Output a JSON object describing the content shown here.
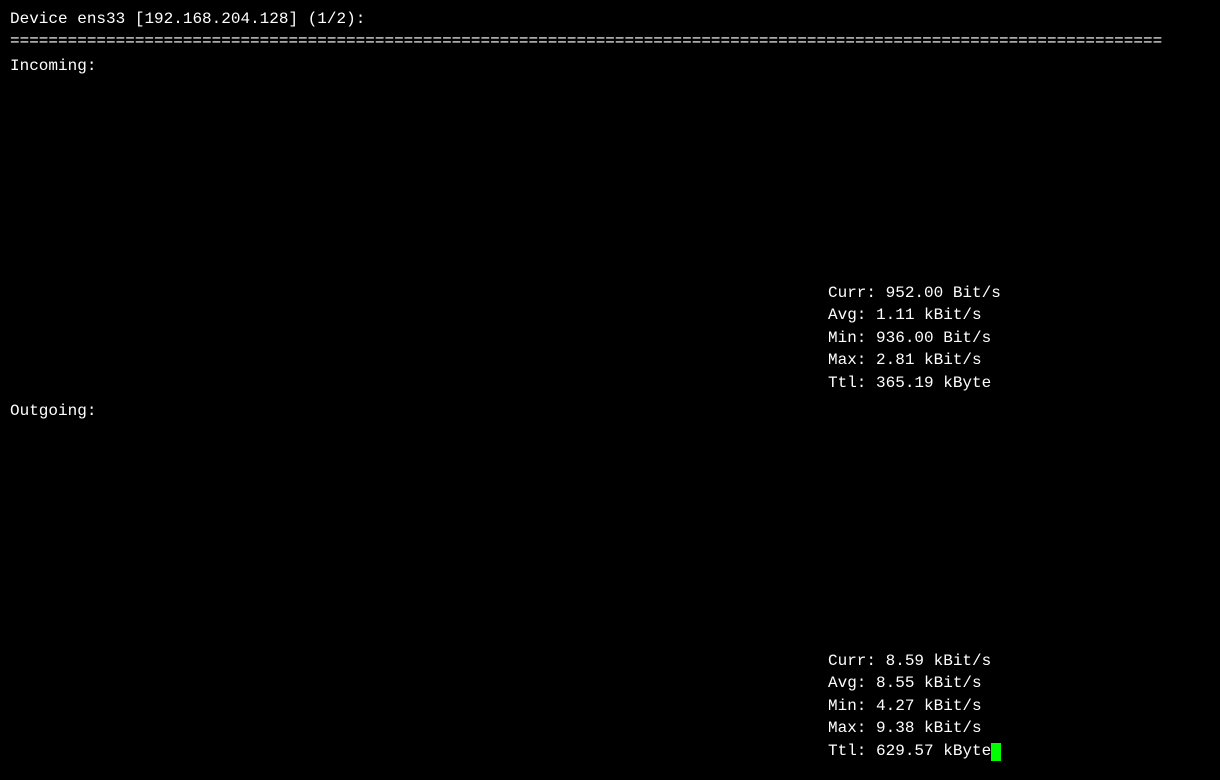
{
  "header": {
    "device_label": "Device",
    "device_name": "ens33",
    "ip_address": "[192.168.204.128]",
    "counter": "(1/2):"
  },
  "separator": "========================================================================================================================",
  "incoming": {
    "label": "Incoming:",
    "stats": {
      "curr": "Curr: 952.00 Bit/s",
      "avg": "Avg: 1.11 kBit/s",
      "min": "Min: 936.00 Bit/s",
      "max": "Max: 2.81 kBit/s",
      "ttl": "Ttl: 365.19 kByte"
    }
  },
  "outgoing": {
    "label": "Outgoing:",
    "stats": {
      "curr": "Curr: 8.59 kBit/s",
      "avg": "Avg: 8.55 kBit/s",
      "min": "Min: 4.27 kBit/s",
      "max": "Max: 9.38 kBit/s",
      "ttl": "Ttl: 629.57 kByte"
    }
  }
}
